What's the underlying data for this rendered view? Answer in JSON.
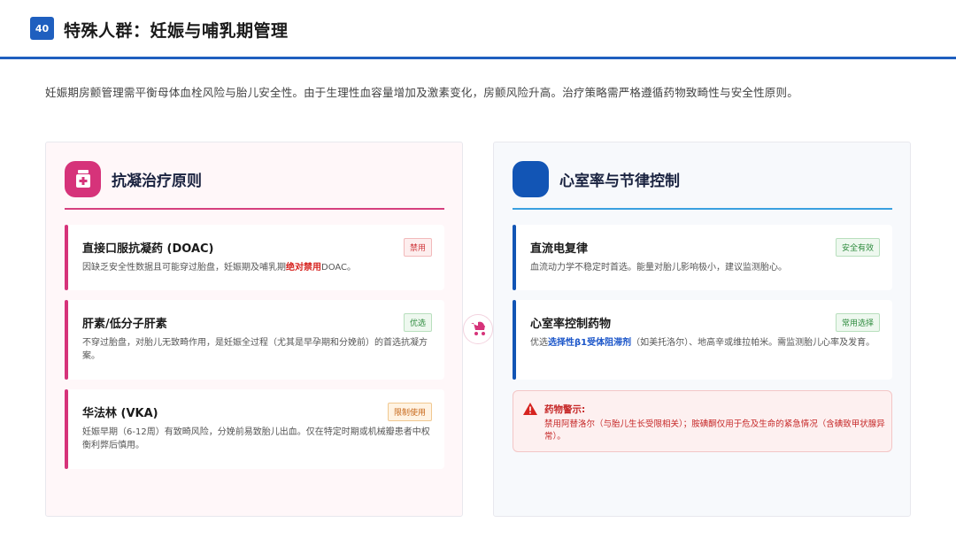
{
  "header": {
    "page_number": "40",
    "title": "特殊人群：妊娠与哺乳期管理"
  },
  "intro": "妊娠期房颤管理需平衡母体血栓风险与胎儿安全性。由于生理性血容量增加及激素变化，房颤风险升高。治疗策略需严格遵循药物致畸性与安全性原则。",
  "left_panel": {
    "title": "抗凝治疗原则",
    "icon": "medicine-bottle-icon",
    "cards": [
      {
        "title": "直接口服抗凝药 (DOAC)",
        "badge": "禁用",
        "desc_pre": "因缺乏安全性数据且可能穿过胎盘，妊娠期及哺乳期",
        "desc_highlight": "绝对禁用",
        "desc_post": "DOAC。"
      },
      {
        "title": "肝素/低分子肝素",
        "badge": "优选",
        "desc": "不穿过胎盘，对胎儿无致畸作用，是妊娠全过程（尤其是早孕期和分娩前）的首选抗凝方案。"
      },
      {
        "title": "华法林 (VKA)",
        "badge": "限制使用",
        "desc": "妊娠早期（6-12周）有致畸风险，分娩前易致胎儿出血。仅在特定时期或机械瓣患者中权衡利弊后慎用。"
      }
    ]
  },
  "right_panel": {
    "title": "心室率与节律控制",
    "icon": "heart-rhythm-icon",
    "cards": [
      {
        "title": "直流电复律",
        "badge": "安全有效",
        "desc": "血流动力学不稳定时首选。能量对胎儿影响极小，建议监测胎心。"
      },
      {
        "title": "心室率控制药物",
        "badge": "常用选择",
        "desc_pre": "优选",
        "desc_highlight": "选择性β1受体阻滞剂",
        "desc_post": "（如美托洛尔）、地高辛或维拉帕米。需监测胎儿心率及发育。"
      }
    ],
    "warning": {
      "title": "药物警示:",
      "text": "禁用阿替洛尔（与胎儿生长受限相关）；胺碘酮仅用于危及生命的紧急情况（含碘致甲状腺异常）。"
    }
  },
  "center_icon": "baby-stroller-icon",
  "colors": {
    "primary_blue": "#1f5fbf",
    "accent_pink": "#d6337a",
    "accent_navy": "#1255b5",
    "danger_red": "#d6231f"
  }
}
